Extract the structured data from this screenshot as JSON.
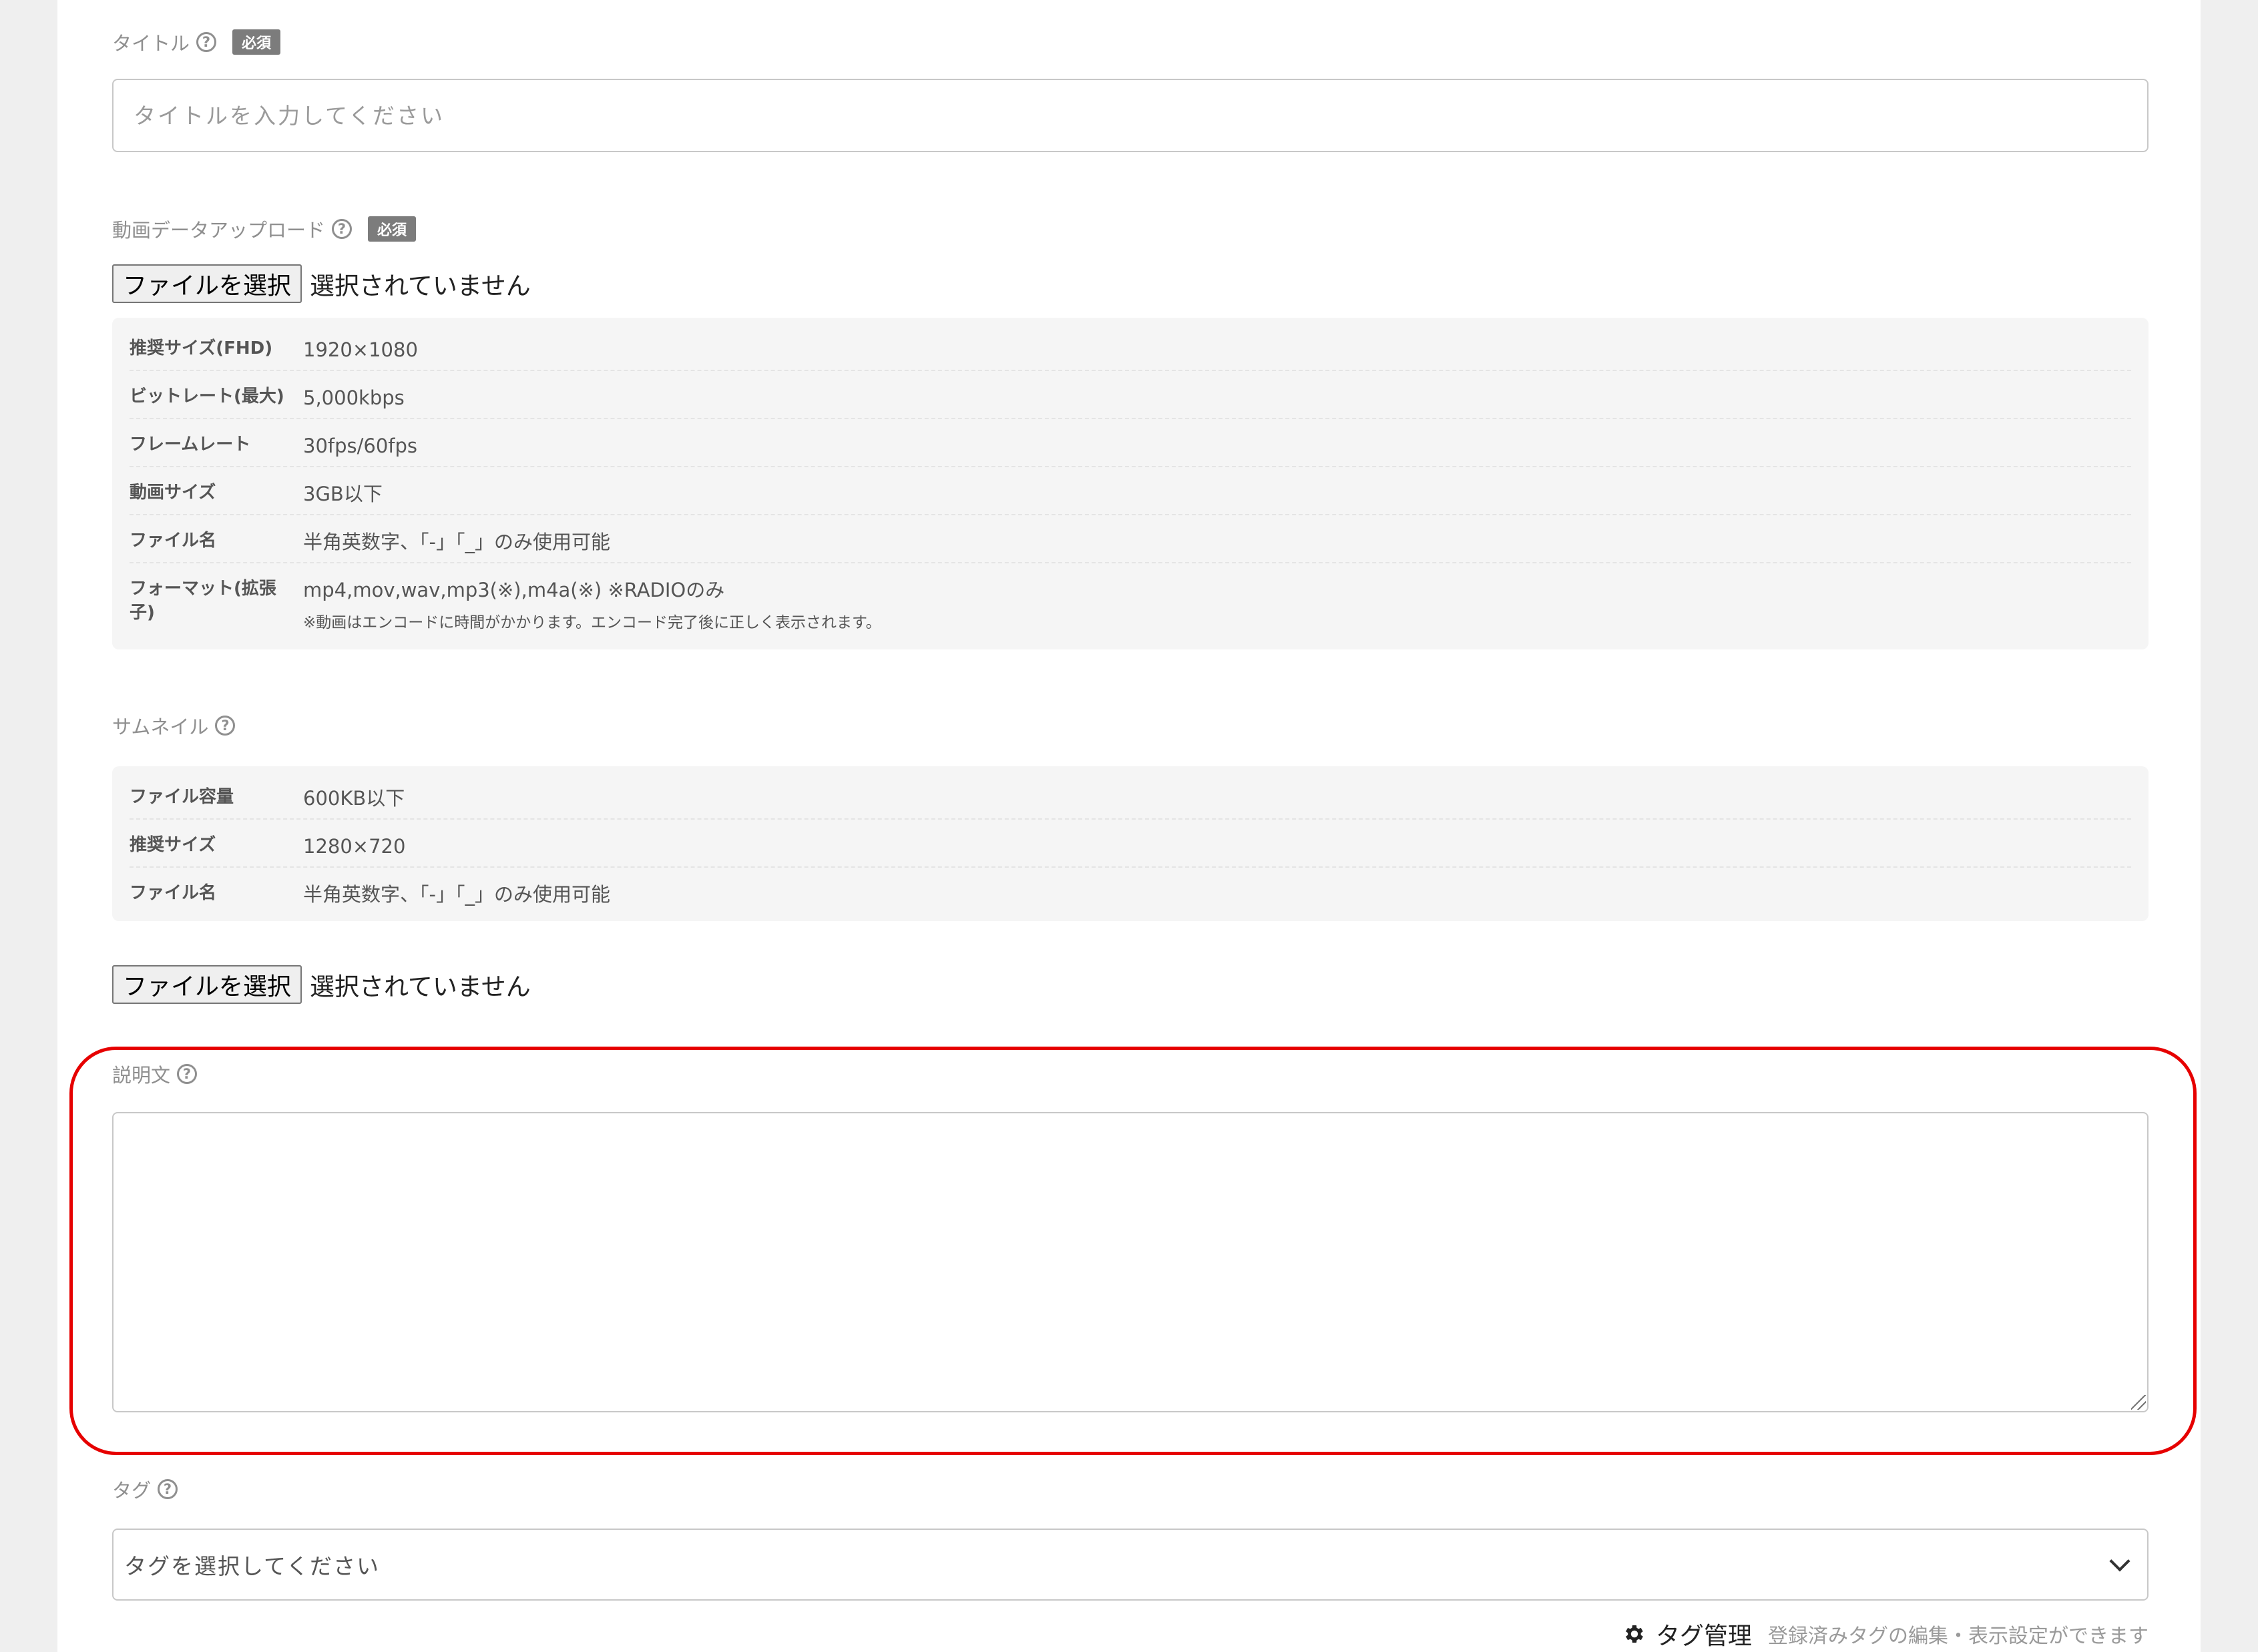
{
  "title_field": {
    "label": "タイトル",
    "required_badge": "必須",
    "placeholder": "タイトルを入力してください"
  },
  "video_upload": {
    "label": "動画データアップロード",
    "required_badge": "必須",
    "file_button": "ファイルを選択",
    "file_status": "選択されていません",
    "specs": [
      {
        "key": "推奨サイズ(FHD)",
        "value": "1920×1080"
      },
      {
        "key": "ビットレート(最大)",
        "value": "5,000kbps"
      },
      {
        "key": "フレームレート",
        "value": "30fps/60fps"
      },
      {
        "key": "動画サイズ",
        "value": "3GB以下"
      },
      {
        "key": "ファイル名",
        "value": "半角英数字、「-」「_」のみ使用可能"
      },
      {
        "key": "フォーマット(拡張子)",
        "value": "mp4,mov,wav,mp3(※),m4a(※) ※RADIOのみ",
        "note": "※動画はエンコードに時間がかかります。エンコード完了後に正しく表示されます。"
      }
    ]
  },
  "thumbnail": {
    "label": "サムネイル",
    "specs": [
      {
        "key": "ファイル容量",
        "value": "600KB以下"
      },
      {
        "key": "推奨サイズ",
        "value": "1280×720"
      },
      {
        "key": "ファイル名",
        "value": "半角英数字、「-」「_」のみ使用可能"
      }
    ],
    "file_button": "ファイルを選択",
    "file_status": "選択されていません"
  },
  "description": {
    "label": "説明文",
    "value": ""
  },
  "tags": {
    "label": "タグ",
    "select_placeholder": "タグを選択してください",
    "manage_link": "タグ管理",
    "manage_desc": "登録済みタグの編集・表示設定ができます"
  },
  "icons": {
    "help": "question-circle-icon",
    "gear": "gear-icon",
    "chevron": "chevron-down-icon"
  },
  "colors": {
    "highlight": "#e60000",
    "badge": "#7c7c7c"
  }
}
